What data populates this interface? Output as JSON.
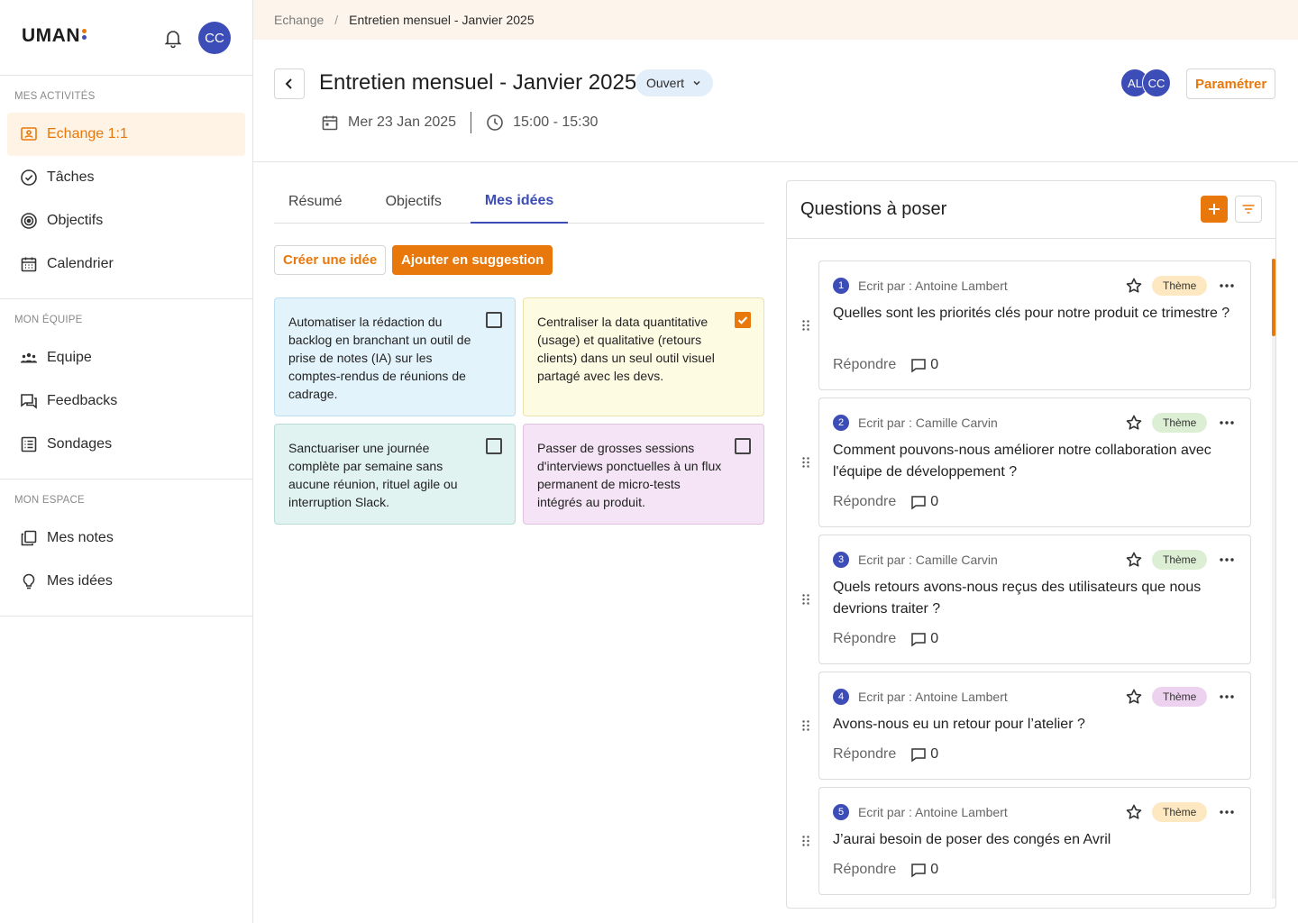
{
  "app": {
    "logo_text": "UMAN",
    "logo_dot_colors": [
      "#e8780b",
      "#3d4db7"
    ],
    "user_initials": "CC"
  },
  "sidebar": {
    "sections": [
      {
        "title": "MES ACTIVITÉS",
        "items": [
          {
            "label": "Echange 1:1",
            "icon": "one-on-one-icon",
            "active": true
          },
          {
            "label": "Tâches",
            "icon": "check-circle-icon"
          },
          {
            "label": "Objectifs",
            "icon": "target-icon"
          },
          {
            "label": "Calendrier",
            "icon": "calendar-icon"
          }
        ]
      },
      {
        "title": "MON ÉQUIPE",
        "items": [
          {
            "label": "Equipe",
            "icon": "team-icon"
          },
          {
            "label": "Feedbacks",
            "icon": "chat-icon"
          },
          {
            "label": "Sondages",
            "icon": "survey-icon"
          }
        ]
      },
      {
        "title": "MON ESPACE",
        "items": [
          {
            "label": "Mes notes",
            "icon": "notes-icon"
          },
          {
            "label": "Mes idées",
            "icon": "lightbulb-icon"
          }
        ]
      }
    ]
  },
  "breadcrumb": {
    "parent": "Echange",
    "separator": "/",
    "current": "Entretien mensuel - Janvier 2025"
  },
  "header": {
    "title": "Entretien mensuel - Janvier 2025",
    "status": "Ouvert",
    "date": "Mer 23 Jan 2025",
    "time": "15:00 - 15:30",
    "participants": [
      "AL",
      "CC"
    ],
    "settings_label": "Paramétrer"
  },
  "tabs": [
    {
      "label": "Résumé"
    },
    {
      "label": "Objectifs"
    },
    {
      "label": "Mes idées",
      "active": true
    }
  ],
  "ideas_actions": {
    "create_label": "Créer une idée",
    "suggest_label": "Ajouter en suggestion"
  },
  "ideas": [
    {
      "text": "Automatiser la rédaction du backlog en branchant un outil de prise de notes (IA) sur les comptes-rendus de réunions de cadrage.",
      "checked": false,
      "bg": "#e3f3fc",
      "border": "#bcdff1"
    },
    {
      "text": "Centraliser la data quantitative (usage) et qualitative (retours clients) dans un seul outil visuel partagé avec les devs.",
      "checked": true,
      "bg": "#fefbe3",
      "border": "#e9e2b0"
    },
    {
      "text": "Sanctuariser une journée complète par semaine sans aucune réunion, rituel agile ou interruption Slack.",
      "checked": false,
      "bg": "#e1f3f0",
      "border": "#b9ddd6"
    },
    {
      "text": "Passer de grosses sessions d'interviews ponctuelles à un flux permanent de micro-tests intégrés au produit.",
      "checked": false,
      "bg": "#f4e4f5",
      "border": "#dfc3e1"
    }
  ],
  "questions_panel": {
    "title": "Questions à poser",
    "reply_label": "Répondre",
    "questions": [
      {
        "num": "1",
        "author": "Ecrit par : Antoine Lambert",
        "theme": "Thème",
        "theme_color": "#fde8c2",
        "text": "Quelles sont les priorités clés pour notre produit ce trimestre ?",
        "comments": "0"
      },
      {
        "num": "2",
        "author": "Ecrit par : Camille Carvin",
        "theme": "Thème",
        "theme_color": "#dcefd5",
        "text": "Comment pouvons-nous améliorer notre collaboration avec l'équipe de développement ?",
        "comments": "0"
      },
      {
        "num": "3",
        "author": "Ecrit par : Camille Carvin",
        "theme": "Thème",
        "theme_color": "#dcefd5",
        "text": "Quels retours avons-nous reçus des utilisateurs que nous devrions traiter ?",
        "comments": "0"
      },
      {
        "num": "4",
        "author": "Ecrit par : Antoine Lambert",
        "theme": "Thème",
        "theme_color": "#ecd2ef",
        "text": "Avons-nous eu un retour pour l’atelier ?",
        "comments": "0"
      },
      {
        "num": "5",
        "author": "Ecrit par : Antoine Lambert",
        "theme": "Thème",
        "theme_color": "#fde8c2",
        "text": "J’aurai besoin de poser des congés en Avril",
        "comments": "0"
      }
    ]
  },
  "colors": {
    "accent": "#e8780b",
    "primary": "#3d4db7"
  }
}
